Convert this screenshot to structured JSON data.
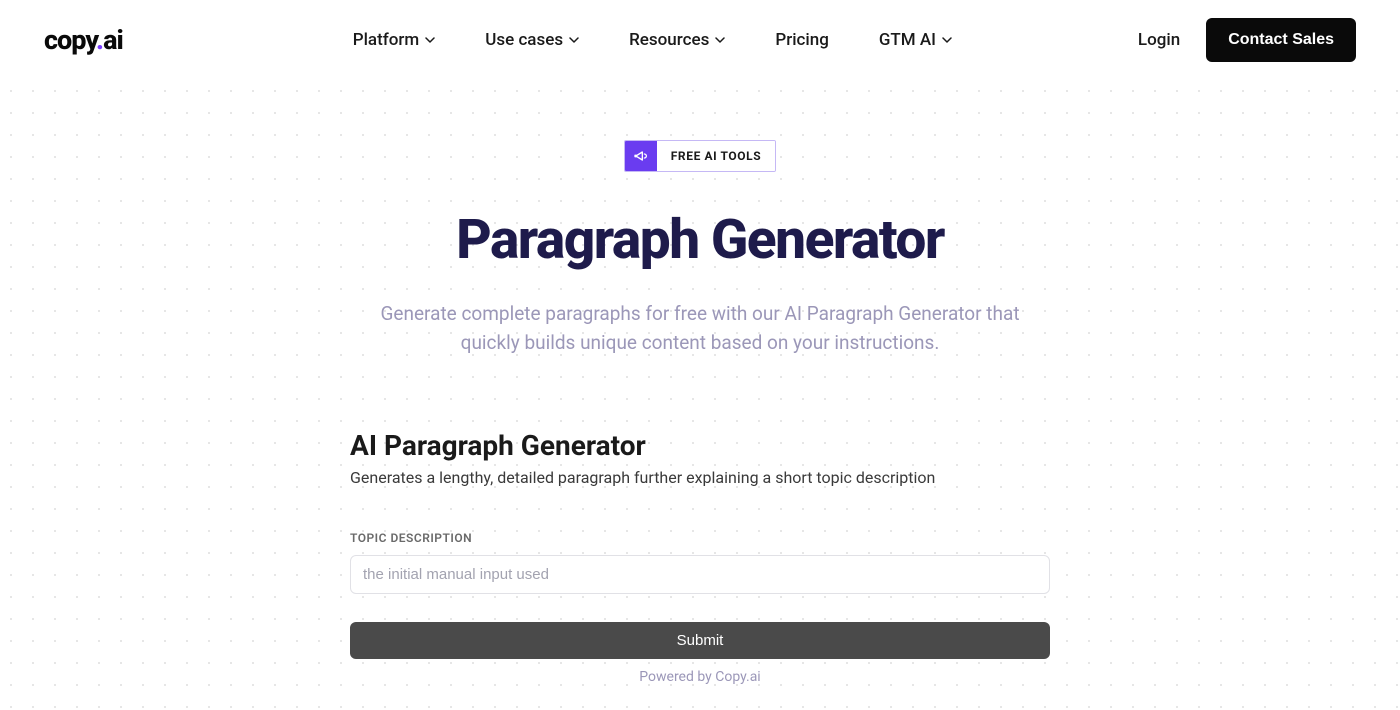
{
  "logo": {
    "part1": "copy",
    "dot": ".",
    "part2": "ai"
  },
  "nav": {
    "items": [
      {
        "label": "Platform",
        "hasDropdown": true
      },
      {
        "label": "Use cases",
        "hasDropdown": true
      },
      {
        "label": "Resources",
        "hasDropdown": true
      },
      {
        "label": "Pricing",
        "hasDropdown": false
      },
      {
        "label": "GTM AI",
        "hasDropdown": true
      }
    ]
  },
  "header": {
    "login": "Login",
    "contact": "Contact Sales"
  },
  "badge": {
    "text": "FREE AI TOOLS"
  },
  "hero": {
    "title": "Paragraph Generator",
    "subtitle": "Generate complete paragraphs for free with our AI Paragraph Generator that quickly builds unique content based on your instructions."
  },
  "tool": {
    "title": "AI Paragraph Generator",
    "description": "Generates a lengthy, detailed paragraph further explaining a short topic description",
    "fieldLabel": "TOPIC DESCRIPTION",
    "placeholder": "the initial manual input used",
    "submit": "Submit",
    "powered": "Powered by Copy.ai"
  }
}
